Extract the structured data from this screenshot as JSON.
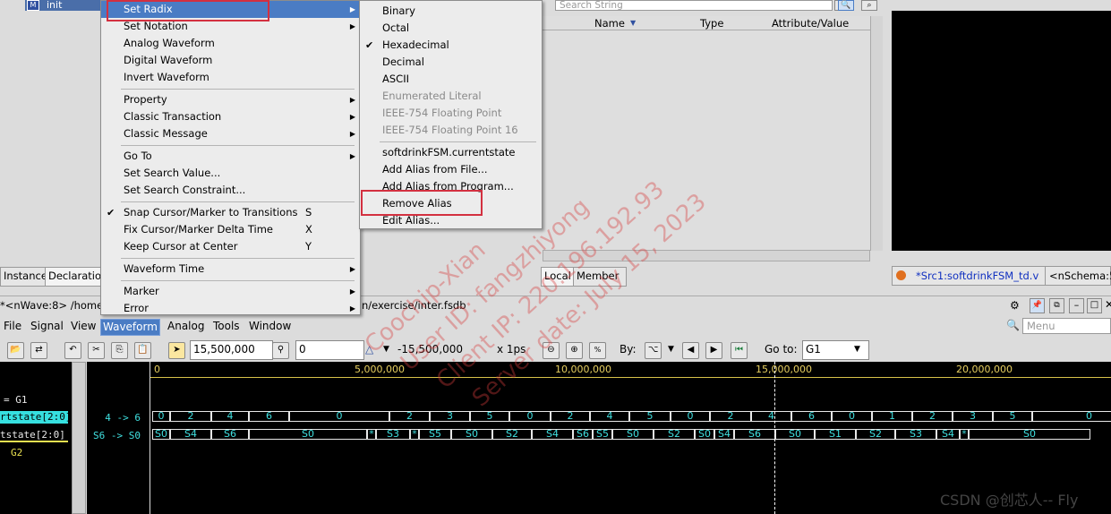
{
  "tree": {
    "item": "init"
  },
  "left_tabs": [
    "Instance",
    "Declaration"
  ],
  "waveform_menu": {
    "items": [
      {
        "label": "Set Radix",
        "arrow": true,
        "highlighted": true
      },
      {
        "label": "Set Notation",
        "arrow": true
      },
      {
        "label": "Analog Waveform"
      },
      {
        "label": "Digital Waveform"
      },
      {
        "label": "Invert Waveform"
      },
      {
        "label": "Property",
        "arrow": true,
        "sep_before": true
      },
      {
        "label": "Classic Transaction",
        "arrow": true
      },
      {
        "label": "Classic Message",
        "arrow": true
      },
      {
        "label": "Go To",
        "arrow": true,
        "sep_before": true
      },
      {
        "label": "Set Search Value..."
      },
      {
        "label": "Set Search Constraint..."
      },
      {
        "label": "Snap Cursor/Marker to Transitions",
        "key": "S",
        "checked": true,
        "sep_before": true
      },
      {
        "label": "Fix Cursor/Marker Delta Time",
        "key": "X"
      },
      {
        "label": "Keep Cursor at Center",
        "key": "Y"
      },
      {
        "label": "Waveform Time",
        "arrow": true,
        "sep_before": true
      },
      {
        "label": "Marker",
        "arrow": true,
        "sep_before": true
      },
      {
        "label": "Error",
        "arrow": true
      }
    ]
  },
  "radix_menu": {
    "items": [
      {
        "label": "Binary"
      },
      {
        "label": "Octal"
      },
      {
        "label": "Hexadecimal",
        "checked": true
      },
      {
        "label": "Decimal"
      },
      {
        "label": "ASCII"
      },
      {
        "label": "Enumerated Literal",
        "disabled": true
      },
      {
        "label": "IEEE-754 Floating Point",
        "disabled": true
      },
      {
        "label": "IEEE-754 Floating Point 16",
        "disabled": true
      },
      {
        "label": "softdrinkFSM.currentstate",
        "sep_before": true
      },
      {
        "label": "Add Alias from File..."
      },
      {
        "label": "Add Alias from Program..."
      },
      {
        "label": "Remove Alias",
        "boxed": true
      },
      {
        "label": "Edit Alias..."
      }
    ]
  },
  "search": {
    "placeholder": "Search String"
  },
  "signal_table": {
    "columns": [
      "Name",
      "Type",
      "Attribute/Value"
    ]
  },
  "right_tabs": [
    "Local",
    "Member"
  ],
  "source_tab": {
    "label": "*Src1:softdrinkFSM_td.v",
    "label2": "<nSchema:5"
  },
  "status": {
    "left": "*<nWave:8> /home",
    "right": "n/exercise/inter.fsdb"
  },
  "menubar": [
    "File",
    "Signal",
    "View",
    "Waveform",
    "Analog",
    "Tools",
    "Window"
  ],
  "menubar_active": "Waveform",
  "menu_search": {
    "placeholder": "Menu"
  },
  "toolbar": {
    "cursor_time": "15,500,000",
    "marker_time": "0",
    "delta": "-15,500,000",
    "unit": "x 1ps",
    "by_label": "By:",
    "goto_label": "Go to:",
    "goto_value": "G1"
  },
  "wave": {
    "ruler_ticks": [
      "0",
      "5,000,000",
      "10,000,000",
      "15,000,000",
      "20,000,000"
    ],
    "signal_names": [
      "= G1",
      "rtstate[2:0]",
      "tstate[2:0]",
      "G2"
    ],
    "values": [
      "4 -> 6",
      "S6 -> S0"
    ],
    "row1": [
      "0",
      "2",
      "4",
      "6",
      "0",
      "2",
      "3",
      "5",
      "0",
      "2",
      "4",
      "5",
      "0",
      "2",
      "4",
      "6",
      "0",
      "1",
      "2",
      "3",
      "5",
      "0"
    ],
    "row2": [
      "S0",
      "S4",
      "S6",
      "S0",
      "*",
      "S3",
      "*",
      "S5",
      "S0",
      "S2",
      "S4",
      "S6",
      "S5",
      "S0",
      "S2",
      "S0",
      "S4",
      "S6",
      "S0",
      "S1",
      "S2",
      "S3",
      "S4",
      "*",
      "S0"
    ]
  },
  "watermark": [
    "Coochip-Xian",
    "User ID: fangzhiyong",
    "Client IP: 220.196.192.93",
    "Server date: July 15, 2023"
  ],
  "credit": "CSDN @创芯人-- Fly"
}
